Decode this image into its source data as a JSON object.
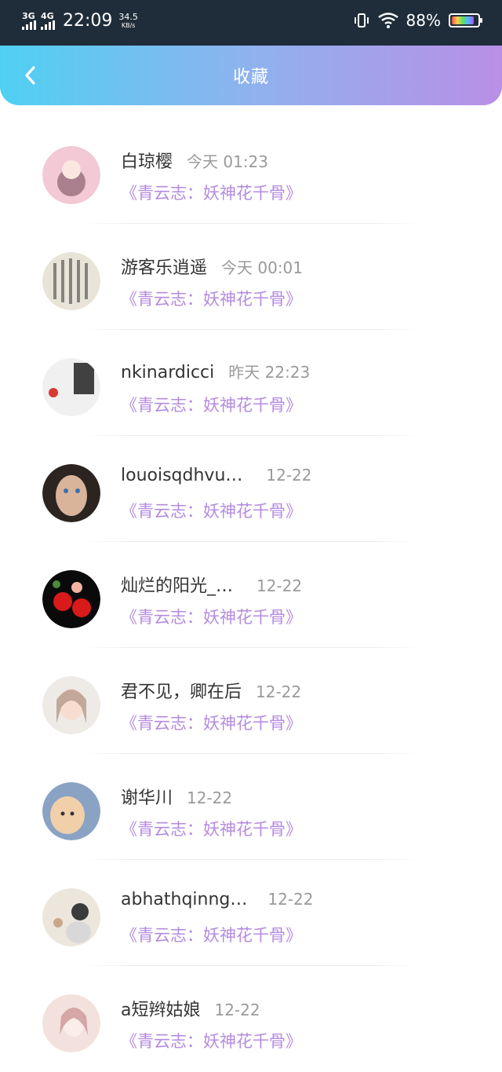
{
  "status_bar": {
    "net1": "3G",
    "net2": "4G",
    "time": "22:09",
    "speed_value": "34.5",
    "speed_unit": "KB/s",
    "battery_pct": "88%",
    "battery_level": 0.88
  },
  "header": {
    "title": "收藏",
    "back_icon": "chevron-left-icon"
  },
  "items": [
    {
      "name": "白琼樱",
      "time": "今天 01:23",
      "book": "《青云志：妖神花千骨》",
      "avatar_colors": [
        "#f2c9d4",
        "#7a5060"
      ]
    },
    {
      "name": "游客乐逍遥",
      "time": "今天 00:01",
      "book": "《青云志：妖神花千骨》",
      "avatar_colors": [
        "#e8e4d8",
        "#5a5a5a"
      ]
    },
    {
      "name": "nkinardicci",
      "time": "昨天 22:23",
      "book": "《青云志：妖神花千骨》",
      "avatar_colors": [
        "#f0f0f0",
        "#222222"
      ]
    },
    {
      "name": "louoisqdhvu…",
      "time": "12-22",
      "book": "《青云志：妖神花千骨》",
      "avatar_colors": [
        "#2b2420",
        "#d9b39a"
      ]
    },
    {
      "name": "灿烂的阳光_…",
      "time": "12-22",
      "book": "《青云志：妖神花千骨》",
      "avatar_colors": [
        "#0a0a0a",
        "#d81a1a"
      ]
    },
    {
      "name": "君不见，卿在后",
      "time": "12-22",
      "book": "《青云志：妖神花千骨》",
      "avatar_colors": [
        "#eeeae6",
        "#b69a8a"
      ]
    },
    {
      "name": "谢华川",
      "time": "12-22",
      "book": "《青云志：妖神花千骨》",
      "avatar_colors": [
        "#f1cfa9",
        "#8aa3c4"
      ]
    },
    {
      "name": "abhathqinng…",
      "time": "12-22",
      "book": "《青云志：妖神花千骨》",
      "avatar_colors": [
        "#ede6dc",
        "#3b3b3b"
      ]
    },
    {
      "name": "a短辫姑娘",
      "time": "12-22",
      "book": "《青云志：妖神花千骨》",
      "avatar_colors": [
        "#f3e1dd",
        "#c58a8a"
      ]
    }
  ]
}
